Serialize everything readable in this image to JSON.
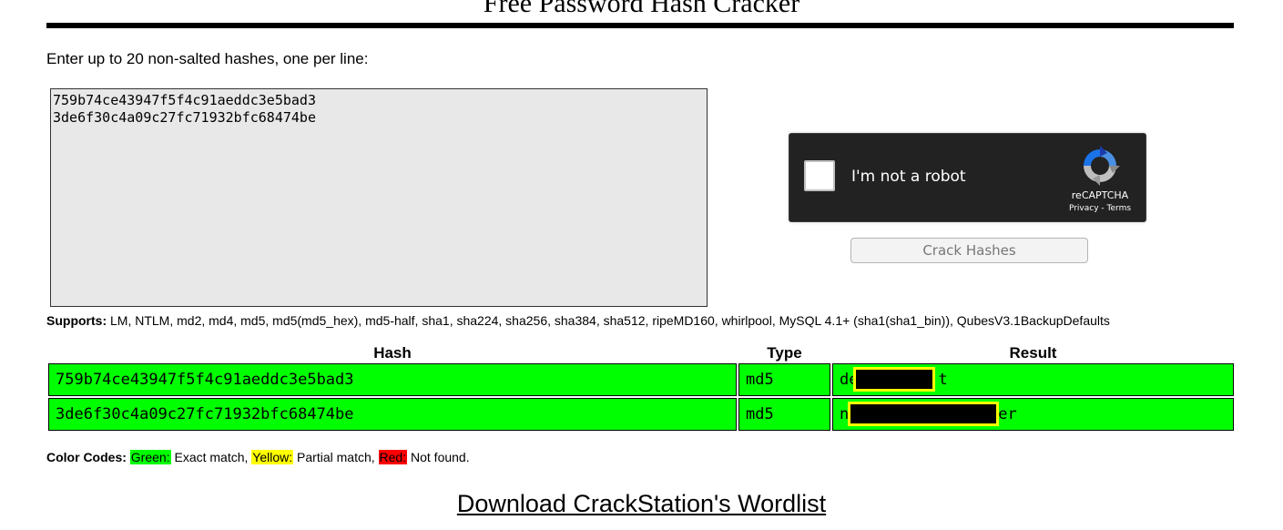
{
  "page": {
    "title": "Free Password Hash Cracker",
    "instructions": "Enter up to 20 non-salted hashes, one per line:"
  },
  "input": {
    "hashes_text": "759b74ce43947f5f4c91aeddc3e5bad3\n3de6f30c4a09c27fc71932bfc68474be"
  },
  "recaptcha": {
    "label": "I'm not a robot",
    "brand": "reCAPTCHA",
    "privacy": "Privacy",
    "separator": " - ",
    "terms": "Terms",
    "checked": false,
    "logo_icon": "recaptcha-logo-icon"
  },
  "actions": {
    "crack_label": "Crack Hashes"
  },
  "supports": {
    "heading": "Supports:",
    "list": " LM, NTLM, md2, md4, md5, md5(md5_hex), md5-half, sha1, sha224, sha256, sha384, sha512, ripeMD160, whirlpool, MySQL 4.1+ (sha1(sha1_bin)), QubesV3.1BackupDefaults"
  },
  "results": {
    "columns": [
      "Hash",
      "Type",
      "Result"
    ],
    "rows": [
      {
        "hash": "759b74ce43947f5f4c91aeddc3e5bad3",
        "type": "md5",
        "result_start": "de",
        "result_end": "t",
        "redacted": true,
        "status": "exact"
      },
      {
        "hash": "3de6f30c4a09c27fc71932bfc68474be",
        "type": "md5",
        "result_start": "n",
        "result_end": "er",
        "redacted": true,
        "status": "exact"
      }
    ]
  },
  "legend": {
    "heading": "Color Codes:",
    "green_label": "Green:",
    "green_text": " Exact match, ",
    "yellow_label": "Yellow:",
    "yellow_text": " Partial match, ",
    "red_label": "Red:",
    "red_text": " Not found."
  },
  "download": {
    "link_text": "Download CrackStation's Wordlist"
  },
  "colors": {
    "exact": "#00ff00",
    "partial": "#ffff00",
    "not_found": "#ff0000",
    "redaction_border": "#ffff00"
  }
}
